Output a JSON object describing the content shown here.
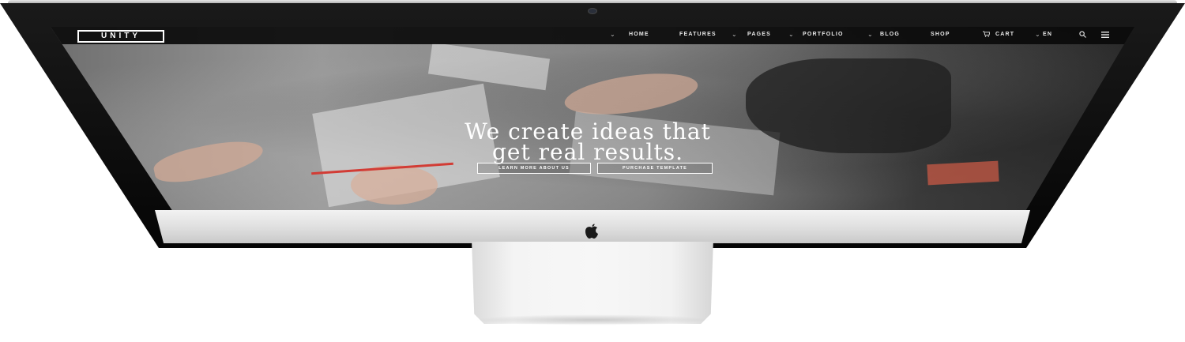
{
  "site": {
    "logo": "UNITY"
  },
  "nav": {
    "items": [
      {
        "label": "HOME",
        "dropdown": true
      },
      {
        "label": "FEATURES",
        "dropdown": true
      },
      {
        "label": "PAGES",
        "dropdown": true
      },
      {
        "label": "PORTFOLIO",
        "dropdown": true
      },
      {
        "label": "BLOG",
        "dropdown": true
      },
      {
        "label": "SHOP",
        "dropdown": false
      }
    ],
    "cart_label": "CART",
    "language": "EN",
    "icons": [
      "chevron-down-icon",
      "cart-icon",
      "search-icon",
      "menu-icon"
    ]
  },
  "hero": {
    "title_line1": "We create ideas that",
    "title_line2": "get real results.",
    "primary_button": "LEARN MORE ABOUT US",
    "secondary_button": "PURCHASE TEMPLATE"
  },
  "colors": {
    "nav_background": "#0a0a0a",
    "text": "#ffffff",
    "device_silver": "#dcdcdc"
  }
}
